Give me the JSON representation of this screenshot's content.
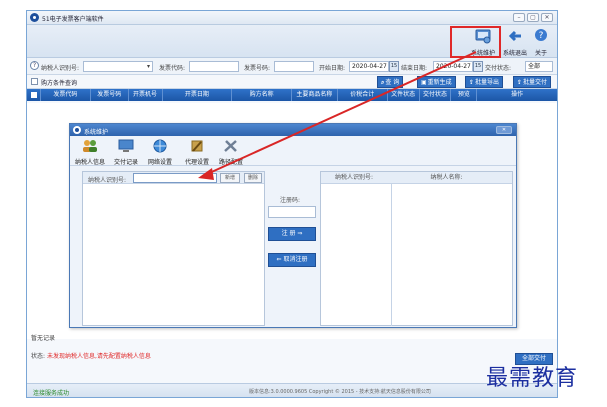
{
  "window": {
    "title": "51电子发票客户端软件",
    "buttons": [
      "–",
      "▢",
      "✕"
    ]
  },
  "toolbar": {
    "system_label": "系统维护",
    "exit_label": "系统退出",
    "about_label": "关于"
  },
  "filters": {
    "taxpayer_label": "纳税人识别号:",
    "invoice_code_label": "发票代码:",
    "invoice_number_label": "发票号码:",
    "start_date_label": "开始日期:",
    "start_date_value": "2020-04-27",
    "end_date_label": "结束日期:",
    "end_date_value": "2020-04-27",
    "delivery_status_label": "交付状态:",
    "delivery_status_value": "全部",
    "calendar_day": "15"
  },
  "subbar": {
    "purchaser_query_label": "购方条件查询",
    "actions": [
      "查 询",
      "重新生成",
      "批量导出",
      "批量交付"
    ]
  },
  "table": {
    "columns": [
      "发票代码",
      "发票号码",
      "开票机号",
      "开票日期",
      "购方名称",
      "主要商品名称",
      "价税合计",
      "文件状态",
      "交付状态",
      "预览",
      "操作"
    ]
  },
  "dialog": {
    "title": "系统维护",
    "close_label": "✕",
    "tools": [
      "纳税人信息",
      "交付记录",
      "网络设置",
      "代理设置",
      "路径配置"
    ],
    "left_panel": {
      "taxpayer_label": "纳税人识别号:",
      "add_label": "新增",
      "delete_label": "删除"
    },
    "middle": {
      "reg_code_label": "注册码:",
      "register_label": "注 册 ⇒",
      "cancel_label": "⇐ 取消注册"
    },
    "right_panel": {
      "taxpayer_col": "纳税人识别号:",
      "name_col": "纳税人名称:"
    }
  },
  "footer": {
    "no_records": "暂无记录",
    "status_key": "状态:",
    "status_value": "未发现纳税人信息,请先配置纳税人信息",
    "button_label": "全部交付",
    "connection": "连接服务成功",
    "version": "版本信息:3.0.0000.9605    Copyright © 2015 -    技术支持:航天信息股份有限公司"
  },
  "watermark": "最需教育",
  "colors": {
    "accent": "#2f6fc2",
    "highlight": "#e02828",
    "success": "#2a8a2a"
  }
}
